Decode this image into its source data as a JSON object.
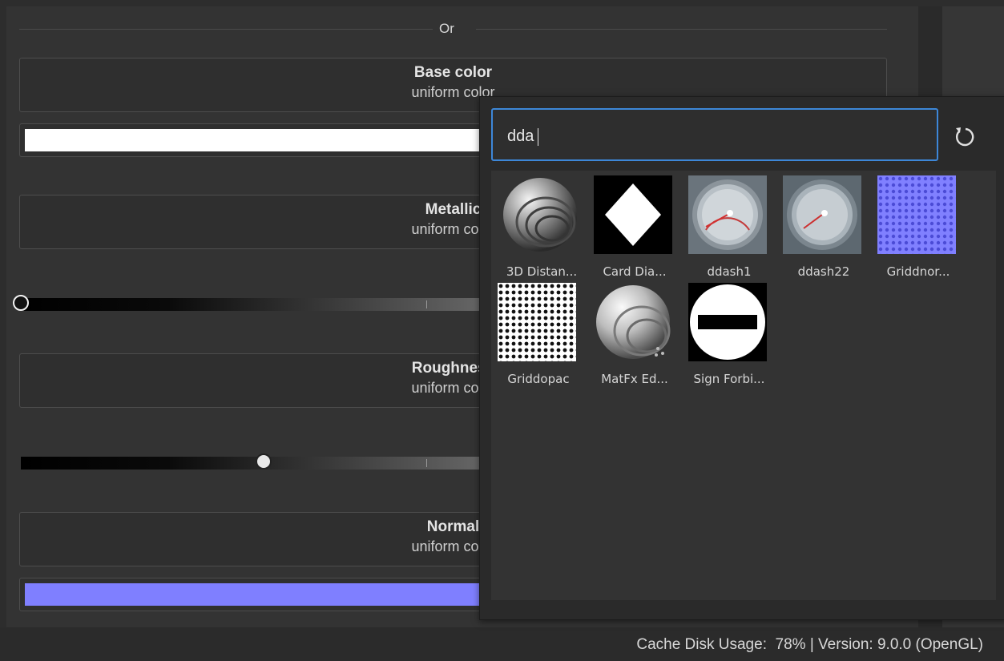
{
  "divider": {
    "label": "Or"
  },
  "sections": [
    {
      "title": "Base color",
      "subtitle": "uniform color"
    },
    {
      "title": "Metallic",
      "subtitle": "uniform color"
    },
    {
      "title": "Roughness",
      "subtitle": "uniform color"
    },
    {
      "title": "Normal",
      "subtitle": "uniform color"
    }
  ],
  "swatches": {
    "base_color": "#ffffff",
    "normal": "#7f7fff"
  },
  "sliders": {
    "metallic": 0.0,
    "roughness": 0.28
  },
  "search_popup": {
    "query": "dda",
    "results": [
      {
        "label": "3D Distan...",
        "icon": "sphere-grooves"
      },
      {
        "label": "Card Dia...",
        "icon": "card-diamond"
      },
      {
        "label": "ddash1",
        "icon": "dashboard-gauge"
      },
      {
        "label": "ddash22",
        "icon": "dashboard-gauge"
      },
      {
        "label": "Griddnor...",
        "icon": "grid-normal"
      },
      {
        "label": "Griddopac",
        "icon": "grid-opacity"
      },
      {
        "label": "MatFx Ed...",
        "icon": "sphere-grooves-light"
      },
      {
        "label": "Sign Forbi...",
        "icon": "sign-forbidden"
      }
    ]
  },
  "status": {
    "text": "Cache Disk Usage:  78% | Version: 9.0.0 (OpenGL)"
  }
}
